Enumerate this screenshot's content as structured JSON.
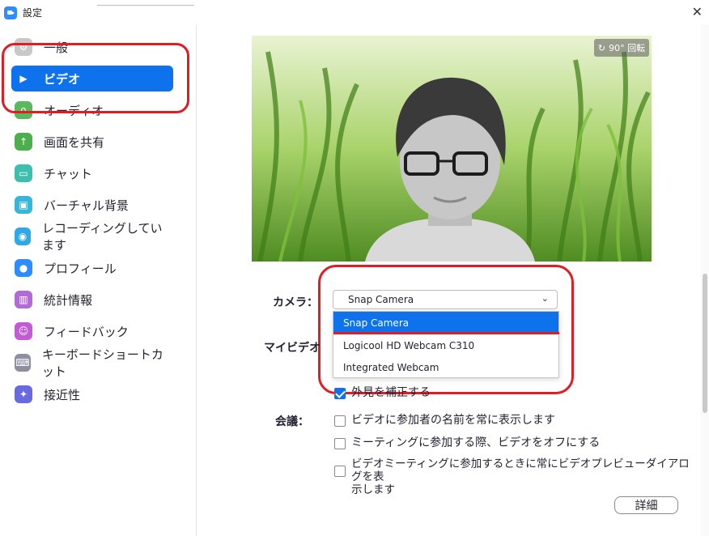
{
  "window": {
    "title": "設定"
  },
  "sidebar": {
    "items": [
      {
        "label": "一般",
        "icon": "gear-icon",
        "color": "#c8c8c8"
      },
      {
        "label": "ビデオ",
        "icon": "video-camera-icon",
        "color": "#0e72ed",
        "active": true
      },
      {
        "label": "オーディオ",
        "icon": "headphones-icon",
        "color": "#5cb85c"
      },
      {
        "label": "画面を共有",
        "icon": "share-screen-icon",
        "color": "#4cae4c"
      },
      {
        "label": "チャット",
        "icon": "chat-bubble-icon",
        "color": "#3cbfae"
      },
      {
        "label": "バーチャル背景",
        "icon": "virtual-background-icon",
        "color": "#38b6d9"
      },
      {
        "label": "レコーディングしています",
        "icon": "record-icon",
        "color": "#2ea8e6"
      },
      {
        "label": "プロフィール",
        "icon": "profile-icon",
        "color": "#2d8cff"
      },
      {
        "label": "統計情報",
        "icon": "statistics-icon",
        "color": "#b36ad4"
      },
      {
        "label": "フィードバック",
        "icon": "feedback-smile-icon",
        "color": "#c45bd6"
      },
      {
        "label": "キーボードショートカット",
        "icon": "keyboard-icon",
        "color": "#8e8ea0"
      },
      {
        "label": "接近性",
        "icon": "accessibility-icon",
        "color": "#6a6ae0"
      }
    ]
  },
  "preview": {
    "rotate_label": "90° 回転"
  },
  "camera": {
    "label": "カメラ：",
    "selected": "Snap Camera",
    "options": [
      "Snap Camera",
      "Logicool HD Webcam C310",
      "Integrated Webcam"
    ]
  },
  "my_video": {
    "label": "マイビデオ",
    "touch_up_label": "外見を補正する",
    "touch_up_checked": true
  },
  "meeting": {
    "label": "会議：",
    "options": [
      {
        "label": "ビデオに参加者の名前を常に表示します",
        "checked": false
      },
      {
        "label": "ミーティングに参加する際、ビデオをオフにする",
        "checked": false
      },
      {
        "label": "ビデオミーティングに参加するときに常にビデオプレビューダイアログを表",
        "label2": "示します",
        "checked": false
      }
    ]
  },
  "detail_button": "詳細",
  "colors": {
    "accent": "#0e72ed",
    "annotation": "#e01c24"
  }
}
